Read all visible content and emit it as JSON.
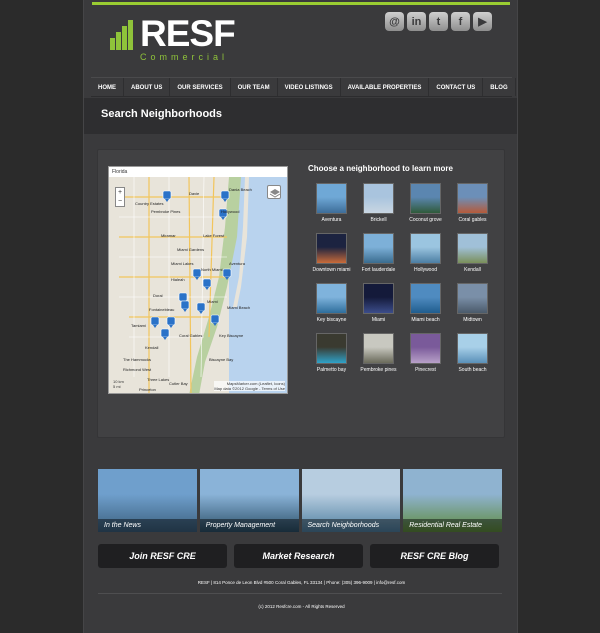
{
  "brand": {
    "name": "RESF",
    "sub": "Commercial",
    "accent": "#8fc33a"
  },
  "social": [
    {
      "icon": "email-icon",
      "glyph": "@"
    },
    {
      "icon": "linkedin-icon",
      "glyph": "in"
    },
    {
      "icon": "twitter-icon",
      "glyph": "t"
    },
    {
      "icon": "facebook-icon",
      "glyph": "f"
    },
    {
      "icon": "youtube-icon",
      "glyph": "▶"
    }
  ],
  "nav": [
    "HOME",
    "ABOUT US",
    "OUR SERVICES",
    "OUR TEAM",
    "VIDEO LISTINGS",
    "AVAILABLE PROPERTIES",
    "CONTACT US",
    "BLOG"
  ],
  "page_title": "Search Neighborhoods",
  "map": {
    "header": "Florida",
    "zoom_in": "+",
    "zoom_out": "−",
    "places": [
      "Country Estates",
      "Davie",
      "Dania Beach",
      "Pembroke Pines",
      "Hollywood",
      "Miramar",
      "Lake Forest",
      "Miami Gardens",
      "Aventura",
      "Miami Lakes",
      "North Miami",
      "Hialeah",
      "Doral",
      "Miami",
      "Fontainebleau",
      "Miami Beach",
      "Tamiami",
      "Coral Gables",
      "Key Biscayne",
      "Kendall",
      "The Hammocks",
      "Richmond West",
      "Three Lakes",
      "Cutler Bay",
      "Princeton",
      "Biscayne Bay"
    ],
    "scale": [
      "10 km",
      "5 mi"
    ],
    "attribution": [
      "MapsMarker.com (Leaflet, Icons)",
      "Map data ©2012 Google - Terms of Use"
    ]
  },
  "neighborhoods_heading": "Choose a neighborhood to learn more",
  "neighborhoods": [
    {
      "label": "Aventura",
      "c1": "#6fa8d6",
      "c2": "#3d6d99"
    },
    {
      "label": "Brickell",
      "c1": "#a9c4de",
      "c2": "#c9d6e2"
    },
    {
      "label": "Coconut grove",
      "c1": "#5b86b0",
      "c2": "#2f5a3a"
    },
    {
      "label": "Coral gables",
      "c1": "#6c8fb8",
      "c2": "#b55a3a"
    },
    {
      "label": "Downtown miami",
      "c1": "#1c2340",
      "c2": "#c96b3a"
    },
    {
      "label": "Fort lauderdale",
      "c1": "#7db0d8",
      "c2": "#3a6c8f"
    },
    {
      "label": "Hollywood",
      "c1": "#9bc5e0",
      "c2": "#4c7ea3"
    },
    {
      "label": "Kendall",
      "c1": "#a0c0d8",
      "c2": "#7a8f5a"
    },
    {
      "label": "Key biscayne",
      "c1": "#7fb3dc",
      "c2": "#2e6e9c"
    },
    {
      "label": "Miami",
      "c1": "#141a3a",
      "c2": "#3c4d8a"
    },
    {
      "label": "Miami beach",
      "c1": "#4f8bc0",
      "c2": "#1f5d8e"
    },
    {
      "label": "Midtown",
      "c1": "#7a8fa8",
      "c2": "#4a5a6a"
    },
    {
      "label": "Palmetto bay",
      "c1": "#3a3a30",
      "c2": "#2fa2c8"
    },
    {
      "label": "Pembroke pines",
      "c1": "#c8c8c0",
      "c2": "#6a6a5a"
    },
    {
      "label": "Pinecrest",
      "c1": "#7a5a9a",
      "c2": "#b8a0c8"
    },
    {
      "label": "South beach",
      "c1": "#a8d0e8",
      "c2": "#5a90b8"
    }
  ],
  "tiles": [
    {
      "label": "In the News",
      "c1": "#6f9fcc",
      "c2": "#3b5f7d"
    },
    {
      "label": "Property Management",
      "c1": "#8ab3d8",
      "c2": "#2c5068"
    },
    {
      "label": "Search Neighborhoods",
      "c1": "#b7cde0",
      "c2": "#4f7fa0"
    },
    {
      "label": "Residential Real Estate",
      "c1": "#8fb3d0",
      "c2": "#5e8a3c"
    }
  ],
  "buttons": [
    "Join RESF CRE",
    "Market Research",
    "RESF CRE Blog"
  ],
  "footer": {
    "address": "RESF | 814 Ponce de Leon Blvd #500 Coral Gables, FL 33134 | Phone: (305) 396-9009 | info@resf.com",
    "copyright": "(c) 2012 Resfcre.com - All Rights Reserved"
  }
}
